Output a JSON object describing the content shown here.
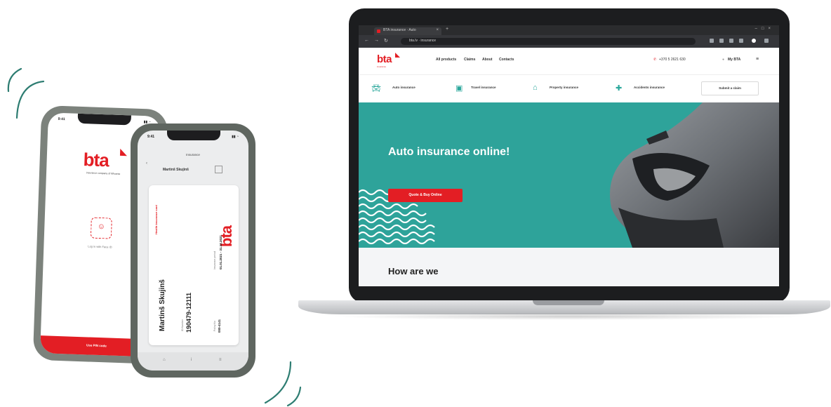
{
  "colors": {
    "brand_red": "#e31e24",
    "teal": "#2ea39a",
    "laptop_frame": "#1c1d1f"
  },
  "browser": {
    "tab_title": "BTA insurance · Auto",
    "url": "bta.lv · insurance"
  },
  "site": {
    "logo": "bta",
    "logo_tagline": "insurance",
    "nav": [
      "All products",
      "Claims",
      "About",
      "Contacts"
    ],
    "phone": "+370 5 2621 630",
    "lang": "My BTA",
    "categories": [
      {
        "icon": "car-icon",
        "label": "Auto insurance"
      },
      {
        "icon": "suitcase-icon",
        "label": "Travel insurance"
      },
      {
        "icon": "house-icon",
        "label": "Property insurance"
      },
      {
        "icon": "accident-icon",
        "label": "Accidents insurance"
      }
    ],
    "claim_button": "Submit a claim",
    "hero_title": "Auto insurance online!",
    "hero_button": "Quote & Buy Online",
    "section_title": "How are we"
  },
  "phone_a": {
    "time": "9:41",
    "logo": "bta",
    "tagline": "insurance company of lithuania",
    "face_id_label": "Log in with Face ID",
    "pin_button": "Use PIN code"
  },
  "phone_b": {
    "time": "9:41",
    "title": "Insurance",
    "header_name": "Martinš Skujinš",
    "card_red_text": "Health insurance card",
    "card_logo": "bta",
    "card_name": "Martinš Skujinš",
    "id_label": "ID Number",
    "id_number": "190479-12111",
    "valid_label": "Policy No",
    "valid_value": "000-4141",
    "policy_label": "Insurance period",
    "policy_value": "01.01.2021 - 31.12.2021",
    "period_label": "Valid",
    "period_value": "2021"
  }
}
